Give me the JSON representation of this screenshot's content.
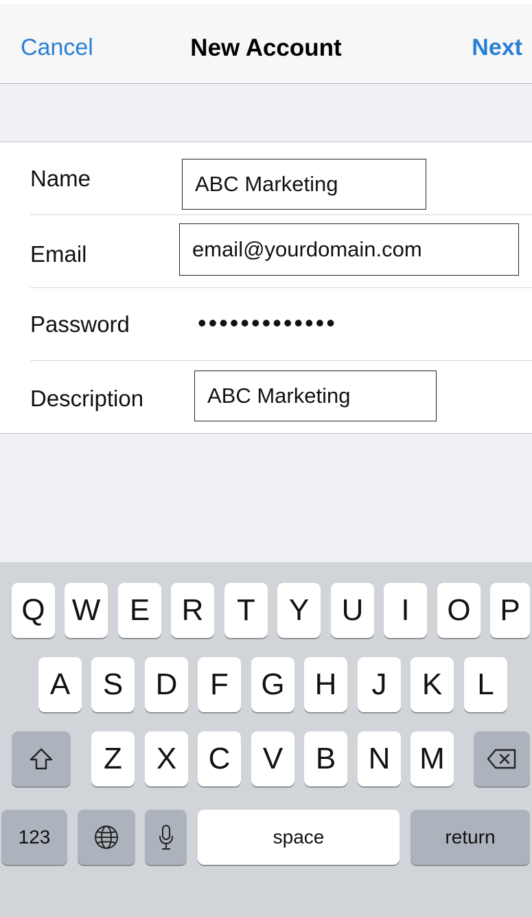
{
  "nav": {
    "cancel_label": "Cancel",
    "title": "New Account",
    "next_label": "Next"
  },
  "form": {
    "name_label": "Name",
    "name_value": "ABC Marketing",
    "email_label": "Email",
    "email_value": "email@yourdomain.com",
    "password_label": "Password",
    "password_masked": "•••••••••••••",
    "description_label": "Description",
    "description_value": "ABC Marketing"
  },
  "keyboard": {
    "row1": [
      "Q",
      "W",
      "E",
      "R",
      "T",
      "Y",
      "U",
      "I",
      "O",
      "P"
    ],
    "row2": [
      "A",
      "S",
      "D",
      "F",
      "G",
      "H",
      "J",
      "K",
      "L"
    ],
    "row3": [
      "Z",
      "X",
      "C",
      "V",
      "B",
      "N",
      "M"
    ],
    "numbers_label": "123",
    "space_label": "space",
    "return_label": "return",
    "shift_icon": "shift-arrow-icon",
    "delete_icon": "backspace-icon",
    "globe_icon": "globe-icon",
    "mic_icon": "microphone-icon"
  },
  "colors": {
    "accent": "#2a7fd4",
    "keyboard_bg": "#d1d4d9",
    "key_bg": "#ffffff",
    "special_key_bg": "#acb3bc"
  }
}
